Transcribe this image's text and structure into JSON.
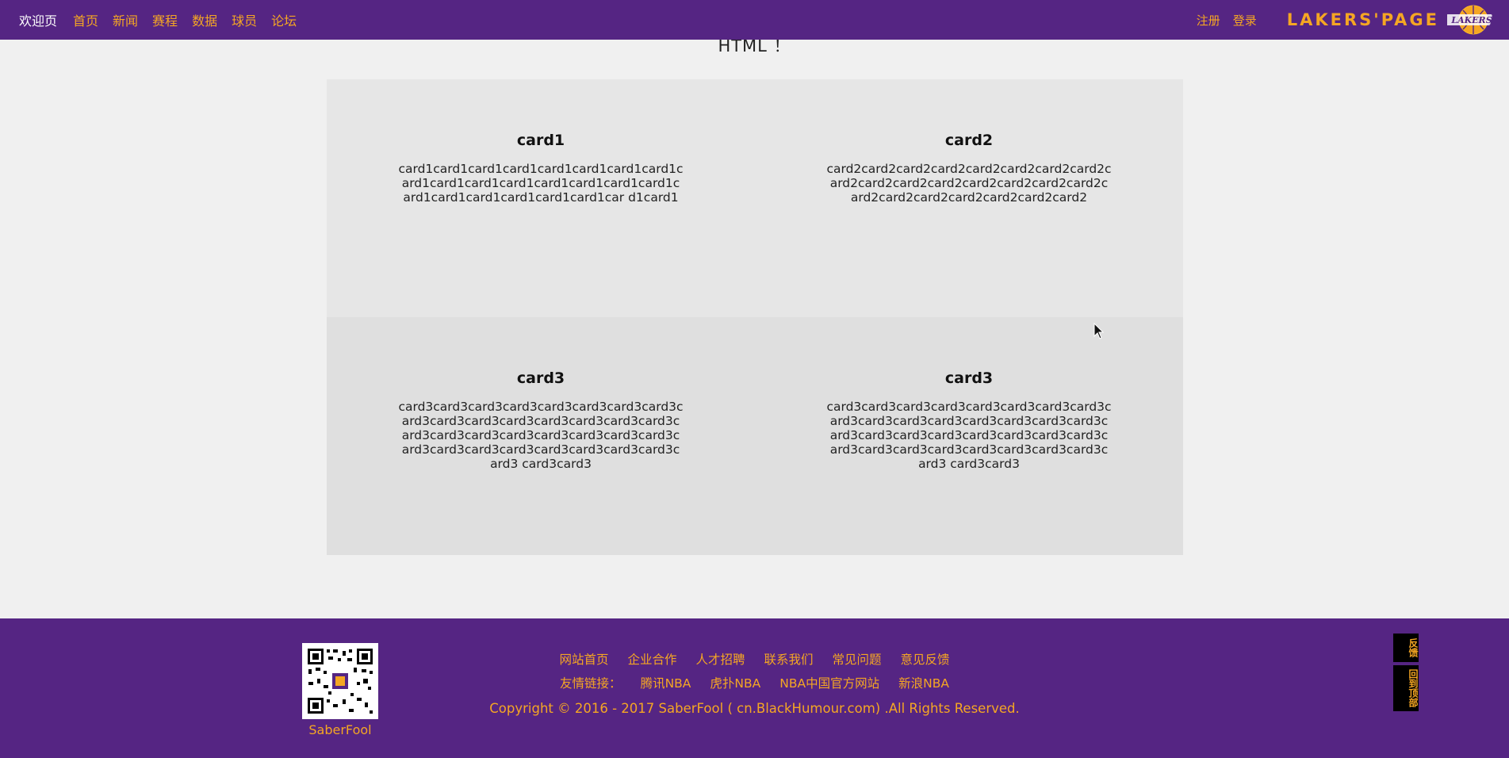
{
  "nav": {
    "active": "欢迎页",
    "links": [
      "首页",
      "新闻",
      "赛程",
      "数据",
      "球员",
      "论坛"
    ],
    "auth": {
      "register": "注册",
      "login": "登录"
    },
    "brand": "LAKERS'PAGE",
    "logo_text": "LAKERS"
  },
  "page": {
    "heading": "HTML ！"
  },
  "cards": [
    {
      "title": "card1",
      "body": "card1card1card1card1card1card1card1card1card1card1card1card1card1card1card1card1card1card1card1card1card1card1car d1card1"
    },
    {
      "title": "card2",
      "body": "card2card2card2card2card2card2card2card2card2card2card2card2card2card2card2card2card2card2card2card2card2card2card2"
    },
    {
      "title": "card3",
      "body": "card3card3card3card3card3card3card3card3card3card3card3card3card3card3card3card3card3card3card3card3card3card3card3card3card3card3card3card3card3card3card3card3card3 card3card3"
    },
    {
      "title": "card3",
      "body": "card3card3card3card3card3card3card3card3card3card3card3card3card3card3card3card3card3card3card3card3card3card3card3card3card3card3card3card3card3card3card3card3card3 card3card3"
    }
  ],
  "footer": {
    "qr_name": "SaberFool",
    "links": [
      "网站首页",
      "企业合作",
      "人才招聘",
      "联系我们",
      "常见问题",
      "意见反馈"
    ],
    "friends_label": "友情链接：",
    "friends": [
      "腾讯NBA",
      "虎扑NBA",
      "NBA中国官方网站",
      "新浪NBA"
    ],
    "copyright": "Copyright © 2016 - 2017 SaberFool ( cn.BlackHumour.com) .All Rights Reserved.",
    "side": {
      "feedback": "反馈",
      "top": "回到顶部"
    }
  },
  "colors": {
    "purple": "#552583",
    "gold": "#f5a623",
    "card_top": "#e6e6e6",
    "card_bottom": "#dfdfdf"
  }
}
